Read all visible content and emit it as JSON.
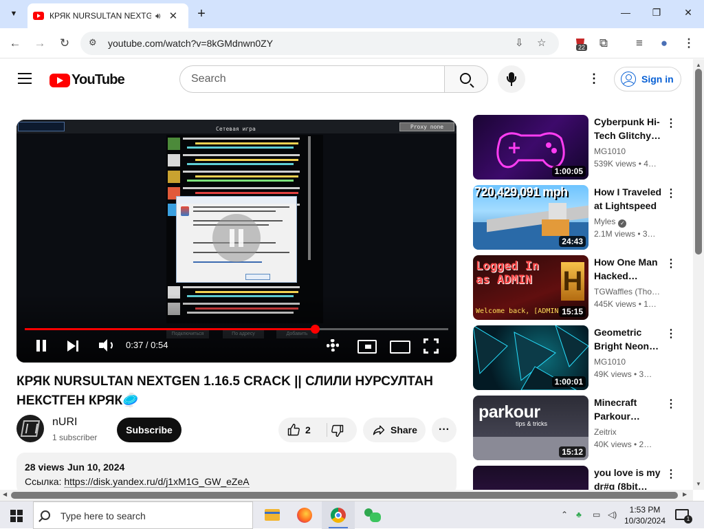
{
  "browser": {
    "tab_title": "КРЯК NURSULTAN NEXTGEN 1.16.5 CRACK || СЛИЛИ НУРСУЛТАН НЕКСТГЕН КРЯК",
    "tab_audio_icon": "speaker-icon",
    "url": "youtube.com/watch?v=8kGMdnwn0ZY",
    "extension_badge": "22"
  },
  "youtube": {
    "logo_text": "YouTube",
    "search_placeholder": "Search",
    "signin_label": "Sign in"
  },
  "player": {
    "current_time": "0:37",
    "separator": " / ",
    "duration": "0:54",
    "time_display": "0:37 / 0:54",
    "progress": 0.685
  },
  "video": {
    "title": "КРЯК NURSULTAN NEXTGEN 1.16.5 CRACK || СЛИЛИ НУРСУЛТАН НЕКСТГЕН КРЯК🥏",
    "channel_name": "nURI",
    "subscribers": "1 subscriber",
    "subscribe_label": "Subscribe",
    "likes": "2",
    "share_label": "Share",
    "views": "28 views",
    "date": "Jun 10, 2024",
    "desc_prefix": "Ссылка: ",
    "desc_link": "https://disk.yandex.ru/d/j1xM1G_GW_eZeA"
  },
  "related": [
    {
      "title": "Cyberpunk Hi-Tech Glitchy…",
      "channel": "MG1010",
      "meta": "539K views • 4…",
      "duration": "1:00:05",
      "verified": false
    },
    {
      "title": "How I Traveled at Lightspeed",
      "channel": "Myles",
      "meta": "2.1M views • 3…",
      "duration": "24:43",
      "verified": true,
      "overlay_text": "720,429,091 mph"
    },
    {
      "title": "How One Man Hacked…",
      "channel": "TGWaffles (Tho…",
      "meta": "445K views • 1…",
      "duration": "15:15",
      "verified": false,
      "overlay_text": "Logged In as ADMIN",
      "overlay_sub": "Welcome back, [ADMIN"
    },
    {
      "title": "Geometric Bright Neon…",
      "channel": "MG1010",
      "meta": "49K views • 3…",
      "duration": "1:00:01",
      "verified": false
    },
    {
      "title": "Minecraft Parkour…",
      "channel": "Zeitrix",
      "meta": "40K views • 2…",
      "duration": "15:12",
      "verified": false,
      "overlay_text": "parkour",
      "overlay_sub": "tips & tricks"
    },
    {
      "title": "you love is my dr#g (8bit…",
      "channel": "",
      "meta": "",
      "duration": "",
      "verified": false
    }
  ],
  "taskbar": {
    "search_text": "Type here to search",
    "time": "1:53 PM",
    "date": "10/30/2024",
    "notification_count": "1"
  }
}
